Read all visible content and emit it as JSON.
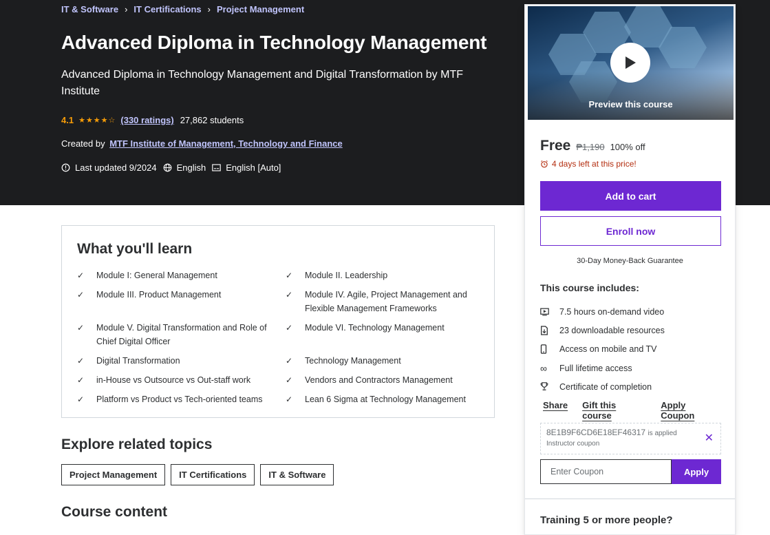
{
  "breadcrumb": [
    "IT & Software",
    "IT Certifications",
    "Project Management"
  ],
  "course": {
    "title": "Advanced Diploma in Technology Management",
    "subtitle": "Advanced Diploma in Technology Management and Digital Transformation by MTF Institute",
    "rating": "4.1",
    "rating_stars": 4.1,
    "ratings_count": "(330 ratings)",
    "students": "27,862 students",
    "created_by_label": "Created by",
    "instructor": "MTF Institute of Management, Technology and Finance",
    "last_updated": "Last updated 9/2024",
    "language": "English",
    "captions": "English [Auto]"
  },
  "learn": {
    "title": "What you'll learn",
    "items": [
      "Module I: General Management",
      "Module II. Leadership",
      "Module III. Product Management",
      "Module IV. Agile, Project Management and Flexible Management Frameworks",
      "Module V. Digital Transformation and Role of Chief Digital Officer",
      "Module VI. Technology Management",
      "Digital Transformation",
      "Technology Management",
      "in-House vs Outsource vs Out-staff work",
      "Vendors and Contractors Management",
      "Platform vs Product vs Tech-oriented teams",
      "Lean 6 Sigma at Technology Management"
    ]
  },
  "related": {
    "title": "Explore related topics",
    "topics": [
      "Project Management",
      "IT Certifications",
      "IT & Software"
    ]
  },
  "course_content_title": "Course content",
  "sidebar": {
    "preview_label": "Preview this course",
    "price": "Free",
    "original_price": "₱1,190",
    "discount": "100% off",
    "timer": "4 days left at this price!",
    "add_to_cart": "Add to cart",
    "enroll_now": "Enroll now",
    "guarantee": "30-Day Money-Back Guarantee",
    "includes_title": "This course includes:",
    "includes": [
      {
        "icon": "video-icon",
        "text": "7.5 hours on-demand video"
      },
      {
        "icon": "file-download-icon",
        "text": "23 downloadable resources"
      },
      {
        "icon": "mobile-icon",
        "text": "Access on mobile and TV"
      },
      {
        "icon": "infinity-icon",
        "text": "Full lifetime access"
      },
      {
        "icon": "trophy-icon",
        "text": "Certificate of completion"
      }
    ],
    "share": "Share",
    "gift": "Gift this course",
    "apply_coupon": "Apply Coupon",
    "coupon_code": "8E1B9F6CD6E18EF46317",
    "coupon_applied_suffix": "is applied",
    "coupon_type": "Instructor coupon",
    "coupon_placeholder": "Enter Coupon",
    "apply_button": "Apply",
    "training_title": "Training 5 or more people?"
  },
  "colors": {
    "hero_bg": "#1c1d1f",
    "link_lavender": "#c0c4fc",
    "star_orange": "#f69c08",
    "primary_purple": "#6d28d2",
    "timer_red": "#b32d0f"
  }
}
